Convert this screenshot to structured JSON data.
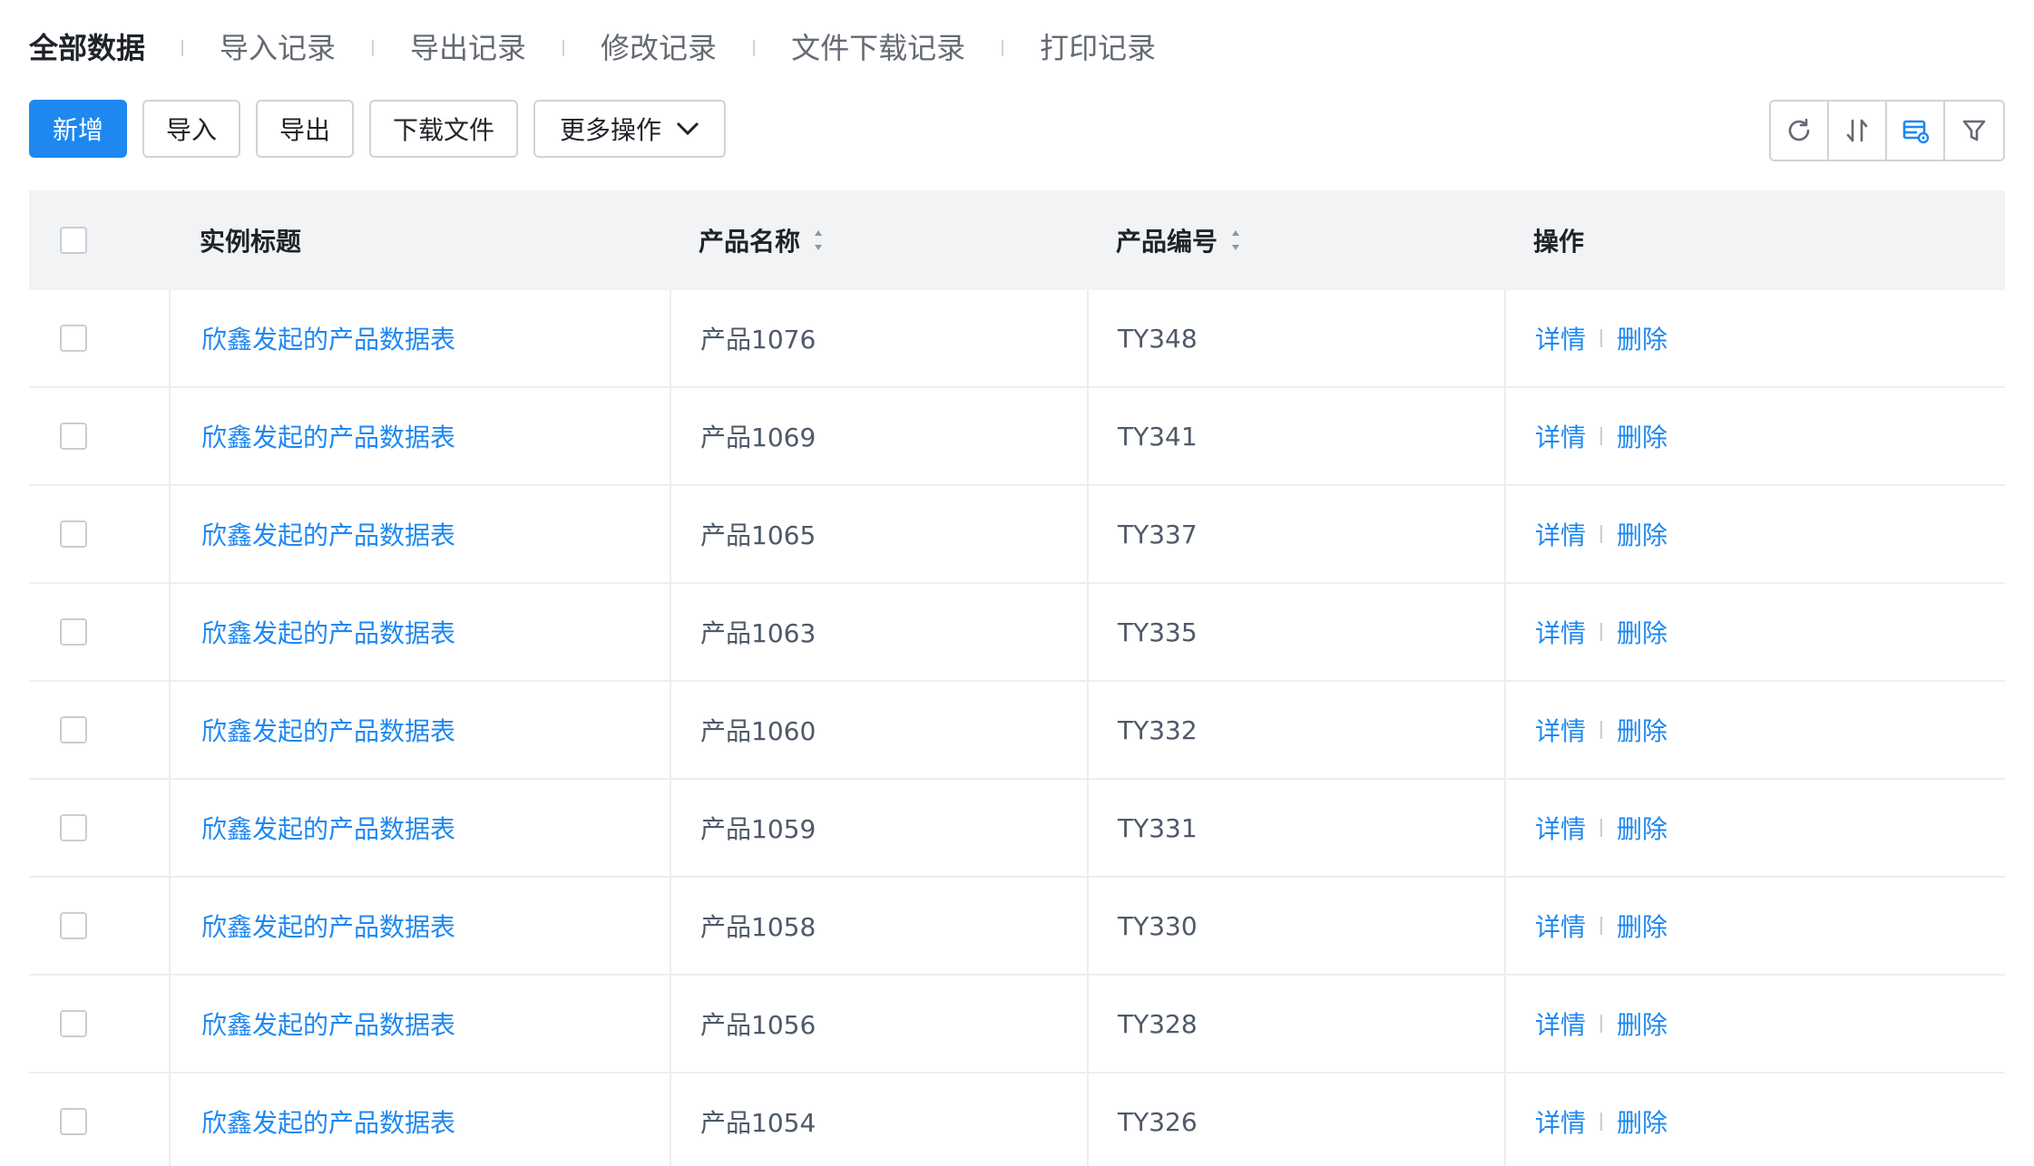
{
  "tabs": [
    {
      "label": "全部数据",
      "active": true
    },
    {
      "label": "导入记录",
      "active": false
    },
    {
      "label": "导出记录",
      "active": false
    },
    {
      "label": "修改记录",
      "active": false
    },
    {
      "label": "文件下载记录",
      "active": false
    },
    {
      "label": "打印记录",
      "active": false
    }
  ],
  "toolbar": {
    "add_label": "新增",
    "import_label": "导入",
    "export_label": "导出",
    "download_label": "下载文件",
    "more_label": "更多操作",
    "icons": [
      "refresh-icon",
      "sort-icon",
      "column-settings-icon",
      "filter-icon"
    ]
  },
  "colors": {
    "accent": "#1e88f0",
    "header_bg": "#f2f3f5",
    "border": "#d0d3d6"
  },
  "table": {
    "columns": [
      "实例标题",
      "产品名称",
      "产品编号",
      "操作"
    ],
    "rows": [
      {
        "title": "欣鑫发起的产品数据表",
        "name": "产品1076",
        "code": "TY348",
        "detail": "详情",
        "delete": "删除"
      },
      {
        "title": "欣鑫发起的产品数据表",
        "name": "产品1069",
        "code": "TY341",
        "detail": "详情",
        "delete": "删除"
      },
      {
        "title": "欣鑫发起的产品数据表",
        "name": "产品1065",
        "code": "TY337",
        "detail": "详情",
        "delete": "删除"
      },
      {
        "title": "欣鑫发起的产品数据表",
        "name": "产品1063",
        "code": "TY335",
        "detail": "详情",
        "delete": "删除"
      },
      {
        "title": "欣鑫发起的产品数据表",
        "name": "产品1060",
        "code": "TY332",
        "detail": "详情",
        "delete": "删除"
      },
      {
        "title": "欣鑫发起的产品数据表",
        "name": "产品1059",
        "code": "TY331",
        "detail": "详情",
        "delete": "删除"
      },
      {
        "title": "欣鑫发起的产品数据表",
        "name": "产品1058",
        "code": "TY330",
        "detail": "详情",
        "delete": "删除"
      },
      {
        "title": "欣鑫发起的产品数据表",
        "name": "产品1056",
        "code": "TY328",
        "detail": "详情",
        "delete": "删除"
      },
      {
        "title": "欣鑫发起的产品数据表",
        "name": "产品1054",
        "code": "TY326",
        "detail": "详情",
        "delete": "删除"
      }
    ]
  }
}
